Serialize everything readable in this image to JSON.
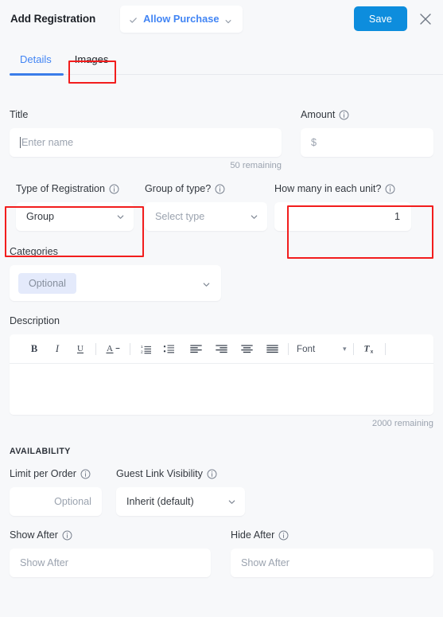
{
  "header": {
    "title": "Add Registration",
    "purchase_pill": {
      "check_icon": "check-icon",
      "label": "Allow Purchase",
      "caret_icon": "chevron-down-icon"
    },
    "save_label": "Save",
    "close_icon": "close-icon",
    "save_color": "#0d8ddd",
    "accent_color": "#4285f4"
  },
  "tabs": [
    {
      "label": "Details",
      "active": true
    },
    {
      "label": "Images",
      "active": false
    }
  ],
  "form": {
    "title": {
      "label": "Title",
      "placeholder": "Enter name",
      "value": "",
      "remaining": "50 remaining"
    },
    "amount": {
      "label": "Amount",
      "placeholder": "$",
      "value": "",
      "info_icon": "info-icon"
    },
    "type_of_registration": {
      "label": "Type of Registration",
      "value": "Group",
      "info_icon": "info-icon",
      "caret_icon": "chevron-down-icon"
    },
    "group_of_type": {
      "label": "Group of type?",
      "placeholder": "Select type",
      "info_icon": "info-icon",
      "caret_icon": "chevron-down-icon"
    },
    "how_many_each_unit": {
      "label": "How many in each unit?",
      "value": "1",
      "info_icon": "info-icon"
    },
    "categories": {
      "label": "Categories",
      "chip_placeholder": "Optional",
      "caret_icon": "chevron-down-icon"
    },
    "description": {
      "label": "Description",
      "remaining": "2000 remaining",
      "toolbar": {
        "bold": "B",
        "italic": "I",
        "underline": "U",
        "text_color": "A",
        "font_label": "Font",
        "font_caret": "▾",
        "items": [
          "bold-icon",
          "italic-icon",
          "underline-icon",
          "text-color-icon",
          "ordered-list-icon",
          "bulleted-list-icon",
          "align-left-icon",
          "align-right-icon",
          "align-center-icon",
          "justify-icon",
          "font-dropdown",
          "clear-formatting-icon"
        ]
      }
    }
  },
  "availability": {
    "section_title": "AVAILABILITY",
    "limit_per_order": {
      "label": "Limit per Order",
      "placeholder": "Optional",
      "info_icon": "info-icon"
    },
    "guest_link_visibility": {
      "label": "Guest Link Visibility",
      "value": "Inherit (default)",
      "info_icon": "info-icon",
      "caret_icon": "chevron-down-icon"
    },
    "show_after": {
      "label": "Show After",
      "placeholder": "Show After",
      "info_icon": "info-icon"
    },
    "hide_after": {
      "label": "Hide After",
      "placeholder": "Show After",
      "info_icon": "info-icon"
    }
  },
  "annotations": {
    "highlight_color": "#f21d1d",
    "boxes": [
      "images-tab",
      "type-of-registration-field",
      "how-many-in-each-unit-field"
    ]
  }
}
